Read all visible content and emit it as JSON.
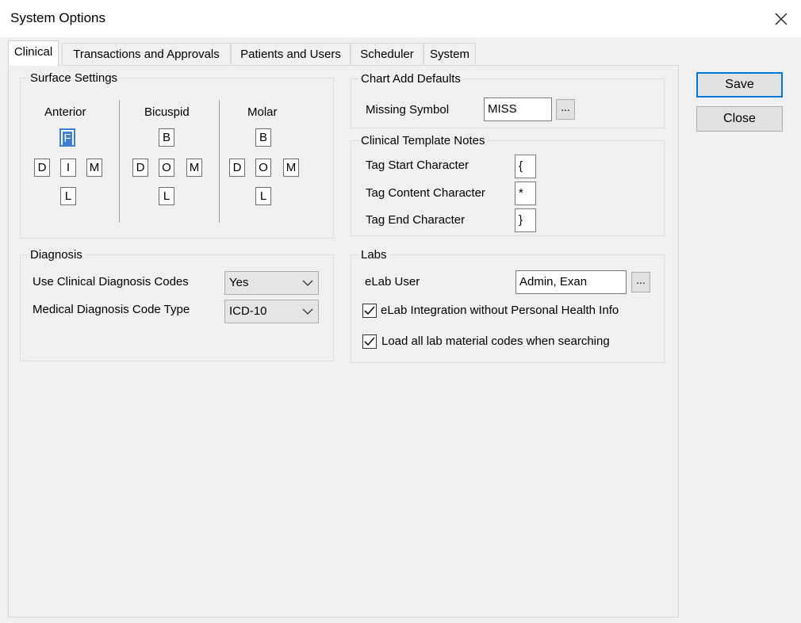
{
  "window": {
    "title": "System Options"
  },
  "tabs": [
    {
      "label": "Clinical"
    },
    {
      "label": "Transactions and Approvals"
    },
    {
      "label": "Patients and Users"
    },
    {
      "label": "Scheduler"
    },
    {
      "label": "System"
    }
  ],
  "surface_settings": {
    "title": "Surface Settings",
    "columns": [
      {
        "label": "Anterior",
        "top": "F",
        "left": "D",
        "mid": "I",
        "right": "M",
        "bottom": "L"
      },
      {
        "label": "Bicuspid",
        "top": "B",
        "left": "D",
        "mid": "O",
        "right": "M",
        "bottom": "L"
      },
      {
        "label": "Molar",
        "top": "B",
        "left": "D",
        "mid": "O",
        "right": "M",
        "bottom": "L"
      }
    ]
  },
  "chart_add_defaults": {
    "title": "Chart Add Defaults",
    "missing_symbol_label": "Missing Symbol",
    "missing_symbol_value": "MISS",
    "ellipsis": "..."
  },
  "clinical_template_notes": {
    "title": "Clinical Template Notes",
    "tag_start_label": "Tag Start Character",
    "tag_start_value": "{",
    "tag_content_label": "Tag Content Character",
    "tag_content_value": "*",
    "tag_end_label": "Tag End Character",
    "tag_end_value": "}"
  },
  "diagnosis": {
    "title": "Diagnosis",
    "clinical_codes_label": "Use Clinical Diagnosis Codes",
    "clinical_codes_value": "Yes",
    "medical_code_type_label": "Medical Diagnosis Code Type",
    "medical_code_type_value": "ICD-10"
  },
  "labs": {
    "title": "Labs",
    "elab_user_label": "eLab User",
    "elab_user_value": "Admin, Exan",
    "ellipsis": "...",
    "phi_label": "eLab Integration without Personal Health Info",
    "phi_checked": true,
    "load_codes_label": "Load all lab material codes when searching",
    "load_codes_checked": true
  },
  "buttons": {
    "save": "Save",
    "close": "Close"
  },
  "colors": {
    "accent": "#0078d7",
    "selected_surface": "#3c7fd6"
  }
}
